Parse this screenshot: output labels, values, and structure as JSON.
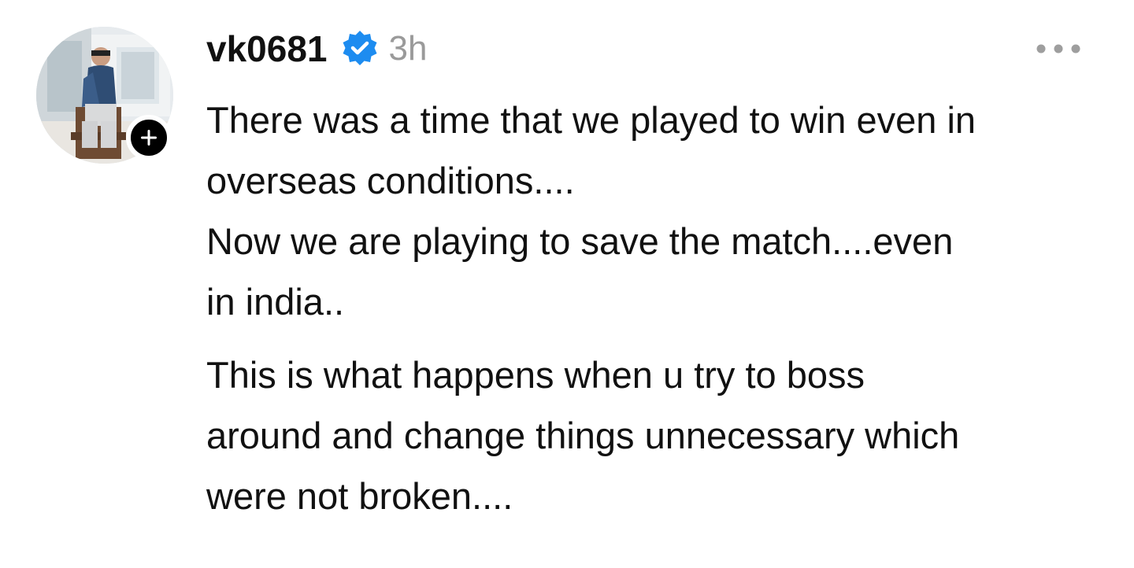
{
  "post": {
    "author": {
      "username": "vk0681",
      "verified": true,
      "verified_color": "#1d8cf0",
      "avatar_icon": "profile-photo",
      "follow_icon": "plus-icon"
    },
    "timestamp": "3h",
    "more_icon": "more-horizontal-icon",
    "paragraphs": [
      {
        "lines": [
          "There was a time that we played to win even in",
          "overseas conditions....",
          "Now we are playing to save the match....even",
          "in india.."
        ]
      },
      {
        "lines": [
          "This is what happens when u try to boss",
          "around and change things unnecessary  which",
          "were not broken...."
        ]
      }
    ]
  },
  "colors": {
    "text": "#111111",
    "muted": "#9a9a9a",
    "badge_bg": "#000000",
    "background": "#ffffff"
  }
}
